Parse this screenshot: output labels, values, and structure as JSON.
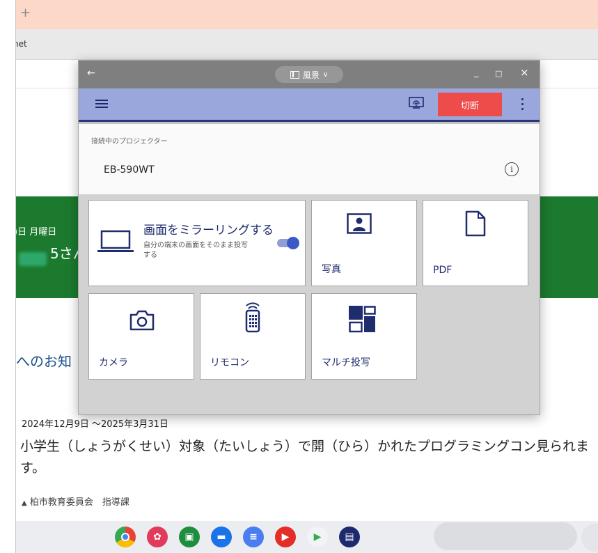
{
  "browser": {
    "new_tab_symbol": "+",
    "url_fragment": "net"
  },
  "background_page": {
    "date_line": ")日 月曜日",
    "greeting": "5さん",
    "news_heading": "へのお知",
    "news_date": "2024年12月9日 ～2025年3月31日",
    "news_body": "小学生（しょうがくせい）対象（たいしょう）で開（ひら）かれたプログラミングコン見られます。",
    "news_org": "柏市教育委員会　指導課"
  },
  "app": {
    "title_bar": {
      "back_symbol": "←",
      "mode_label": "風景",
      "mode_chevron": "∨",
      "minimize": "_",
      "maximize": "□",
      "close": "×"
    },
    "toolbar": {
      "disconnect_label": "切断"
    },
    "projector": {
      "caption": "接続中のプロジェクター",
      "name": "EB-590WT",
      "info_symbol": "i"
    },
    "tiles": {
      "mirror": {
        "title": "画面をミラーリングする",
        "subtitle": "自分の端末の画面をそのまま投写する",
        "enabled": true
      },
      "photo": {
        "label": "写真"
      },
      "pdf": {
        "label": "PDF"
      },
      "camera": {
        "label": "カメラ"
      },
      "remote": {
        "label": "リモコン"
      },
      "multi": {
        "label": "マルチ投写"
      }
    }
  },
  "colors": {
    "toolbar": "#99a7dc",
    "accent_navy": "#1f2c6e",
    "disconnect_red": "#ee4b4b",
    "green_band": "#1c7a2e",
    "tabbar": "#fbd8c8"
  }
}
